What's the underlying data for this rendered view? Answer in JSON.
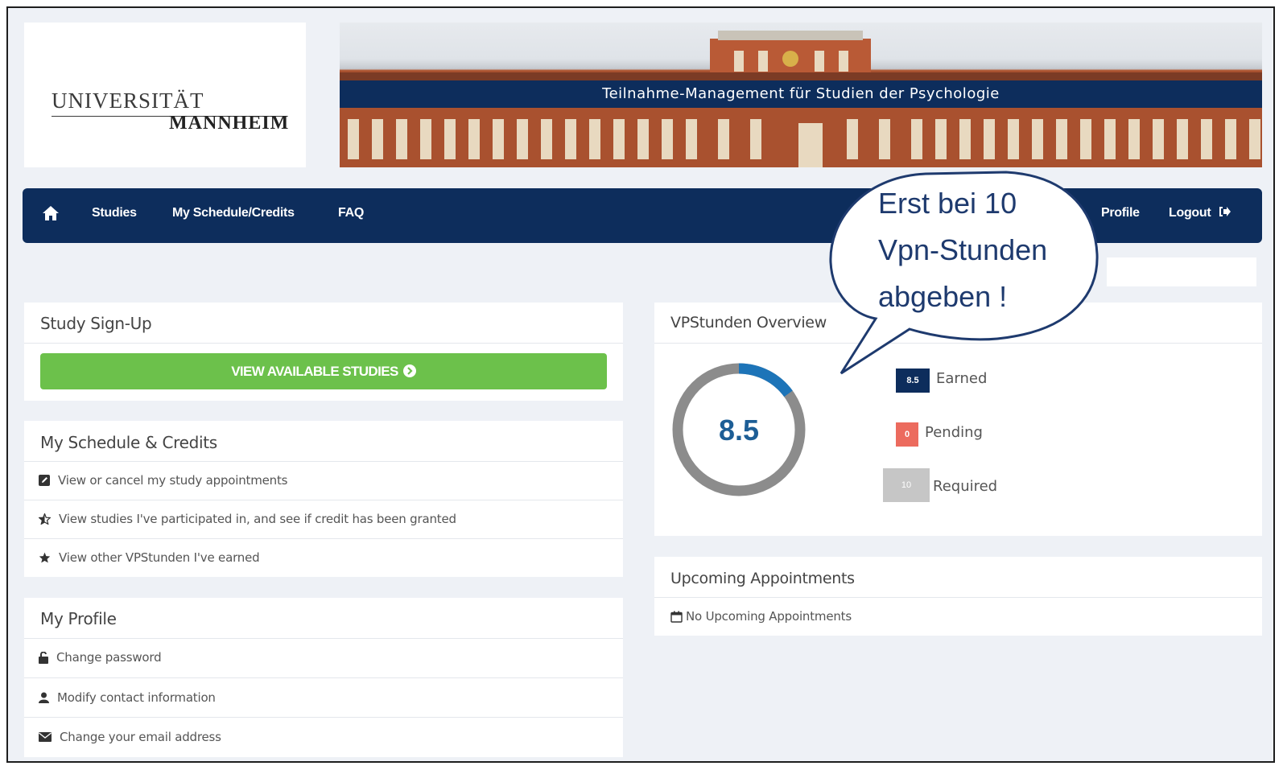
{
  "logo": {
    "line1": "UNIVERSITÄT",
    "line2": "MANNHEIM"
  },
  "banner": {
    "title": "Teilnahme-Management für Studien der Psychologie"
  },
  "nav": {
    "studies": "Studies",
    "schedule": "My Schedule/Credits",
    "faq": "FAQ",
    "profile": "Profile",
    "logout": "Logout"
  },
  "callout": {
    "lines": [
      "Erst bei 10",
      "Vpn-Stunden",
      "abgeben !"
    ]
  },
  "signup": {
    "title": "Study Sign-Up",
    "button": "VIEW AVAILABLE STUDIES"
  },
  "schedule": {
    "title": "My Schedule & Credits",
    "items": [
      "View or cancel my study appointments",
      "View studies I've participated in, and see if credit has been granted",
      "View other VPStunden I've earned"
    ]
  },
  "profile": {
    "title": "My Profile",
    "items": [
      "Change password",
      "Modify contact information",
      "Change your email address"
    ]
  },
  "overview": {
    "title": "VPStunden Overview",
    "earned": 8.5,
    "required": 10,
    "earned_display": "8.5",
    "earned_badge": "8.5",
    "earned_label": "Earned",
    "pending_badge": "0",
    "pending_label": "Pending",
    "required_badge": "10",
    "required_label": "Required",
    "colors": {
      "earned": "#1d74b8",
      "remaining": "#8c8c8c",
      "earned_badge": "#0d2d5c",
      "pending_badge": "#ec6b5e",
      "required_badge": "#c6c6c6"
    }
  },
  "upcoming": {
    "title": "Upcoming Appointments",
    "empty": "No Upcoming Appointments"
  }
}
